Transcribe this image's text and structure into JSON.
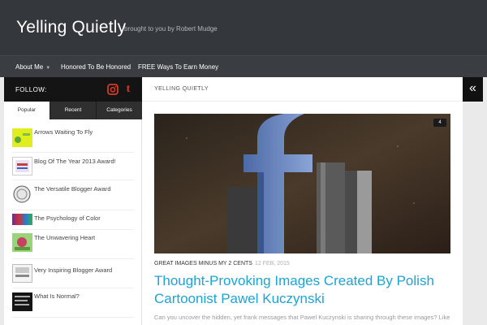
{
  "header": {
    "site_title": "Yelling Quietly",
    "tagline": "brought to you by Robert Mudge"
  },
  "nav": {
    "items": [
      {
        "label": "About Me",
        "has_dropdown": true
      },
      {
        "label": "Honored To Be Honored"
      },
      {
        "label": "FREE Ways To Earn Money"
      }
    ]
  },
  "sidebar": {
    "follow_label": "FOLLOW:",
    "social_icons": [
      "instagram-icon",
      "tumblr-icon"
    ],
    "tumblr_glyph": "t",
    "tabs": [
      {
        "label": "Popular",
        "active": true
      },
      {
        "label": "Recent",
        "active": false
      },
      {
        "label": "Categories",
        "active": false
      }
    ],
    "posts": [
      {
        "title": "Arrows Waiting To Fly"
      },
      {
        "title": "Blog Of The Year 2013 Award!"
      },
      {
        "title": "The Versatile Blogger Award"
      },
      {
        "title": "The Psychology of Color"
      },
      {
        "title": "The Unwavering Heart"
      },
      {
        "title": "Very Inspiring Blogger Award"
      },
      {
        "title": "What Is Normal?"
      }
    ]
  },
  "main": {
    "page_title": "YELLING QUIETLY",
    "featured_post": {
      "comment_count": "4",
      "categories": "GREAT IMAGES MINUS MY 2 CENTS",
      "date": "12 FEB, 2015",
      "title": "Thought-Provoking Images Created By Polish Cartoonist Pawel Kuczynski",
      "excerpt": "Can you uncover the hidden, yet frank messages that Pawel Kuczynski is sharing through these images? Like"
    }
  },
  "collapse_button_glyph": "«",
  "colors": {
    "header_bg": "#34373b",
    "accent_link": "#1fa3d5",
    "follow_bar_bg": "#141414",
    "tumblr_red": "#d33a2c"
  }
}
